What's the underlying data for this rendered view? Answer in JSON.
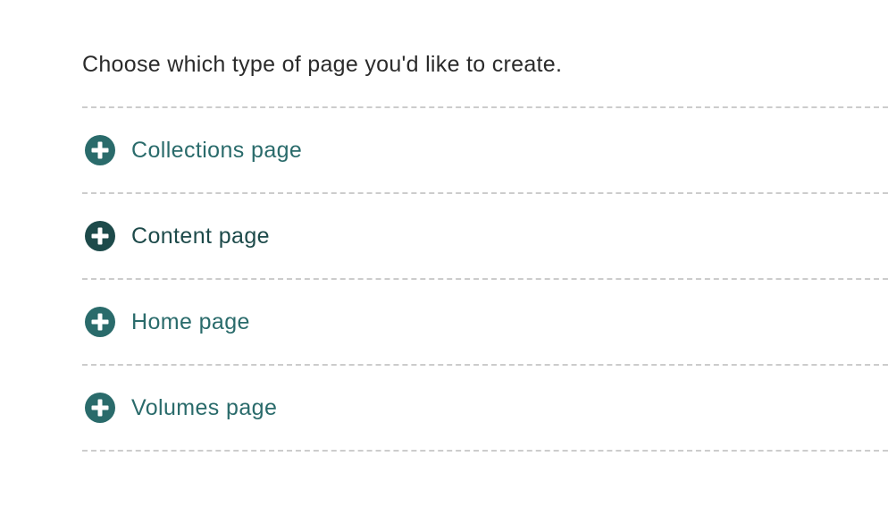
{
  "intro": {
    "text": "Choose which type of page you'd like to create."
  },
  "page_types": {
    "items": [
      {
        "label": "Collections page",
        "icon": "plus-circle-icon"
      },
      {
        "label": "Content page",
        "icon": "plus-circle-icon"
      },
      {
        "label": "Home page",
        "icon": "plus-circle-icon"
      },
      {
        "label": "Volumes page",
        "icon": "plus-circle-icon"
      }
    ]
  },
  "colors": {
    "link": "#2a6b6b",
    "link_hover": "#1d4a4a",
    "text": "#2b2b2b",
    "divider": "#cccccc"
  }
}
